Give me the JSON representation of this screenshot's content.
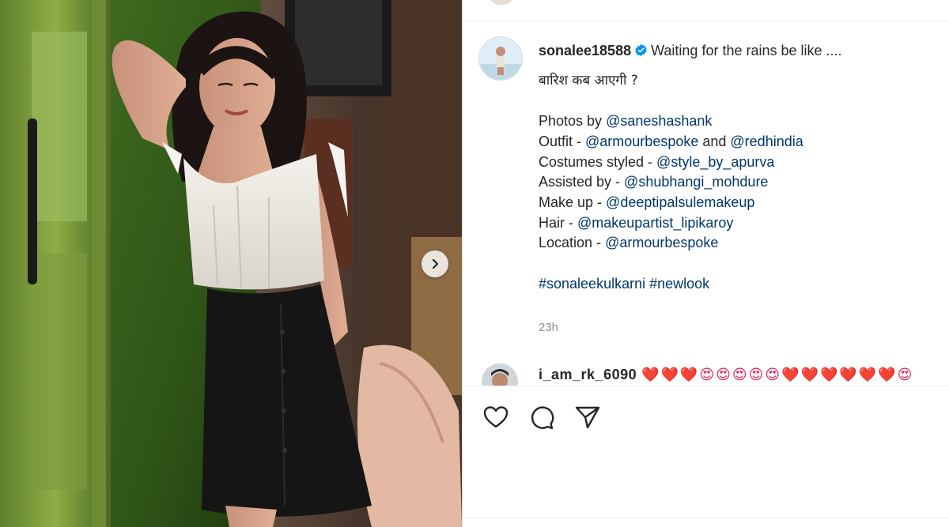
{
  "post": {
    "username": "sonalee18588",
    "caption_first": "Waiting for the rains be like ....",
    "caption_hindi": "बारिश कब आएगी ?",
    "credits": [
      {
        "prefix": "Photos by ",
        "mention": "@saneshashank",
        "joiner": "",
        "mention2": ""
      },
      {
        "prefix": "Outfit - ",
        "mention": "@armourbespoke",
        "joiner": " and ",
        "mention2": "@redhindia"
      },
      {
        "prefix": "Costumes styled - ",
        "mention": "@style_by_apurva",
        "joiner": "",
        "mention2": ""
      },
      {
        "prefix": "Assisted by - ",
        "mention": "@shubhangi_mohdure",
        "joiner": "",
        "mention2": ""
      },
      {
        "prefix": "Make up - ",
        "mention": "@deeptipalsulemakeup",
        "joiner": "",
        "mention2": ""
      },
      {
        "prefix": "Hair - ",
        "mention": "@makeupartist_lipikaroy",
        "joiner": "",
        "mention2": ""
      },
      {
        "prefix": "Location - ",
        "mention": "@armourbespoke",
        "joiner": "",
        "mention2": ""
      }
    ],
    "hashtags": "#sonaleekulkarni #newlook",
    "timestamp": "23h"
  },
  "comment": {
    "username": "i_am_rk_6090",
    "emojis": "❤️❤️❤️😍😍😍😍😍❤️❤️❤️❤️❤️❤️😍"
  },
  "actions": {
    "like_icon": "heart-icon",
    "comment_icon": "comment-bubble-icon",
    "share_icon": "paper-plane-icon"
  },
  "colors": {
    "mention": "#00376b",
    "verified": "#0095f6",
    "muted": "#8e8e8e"
  }
}
